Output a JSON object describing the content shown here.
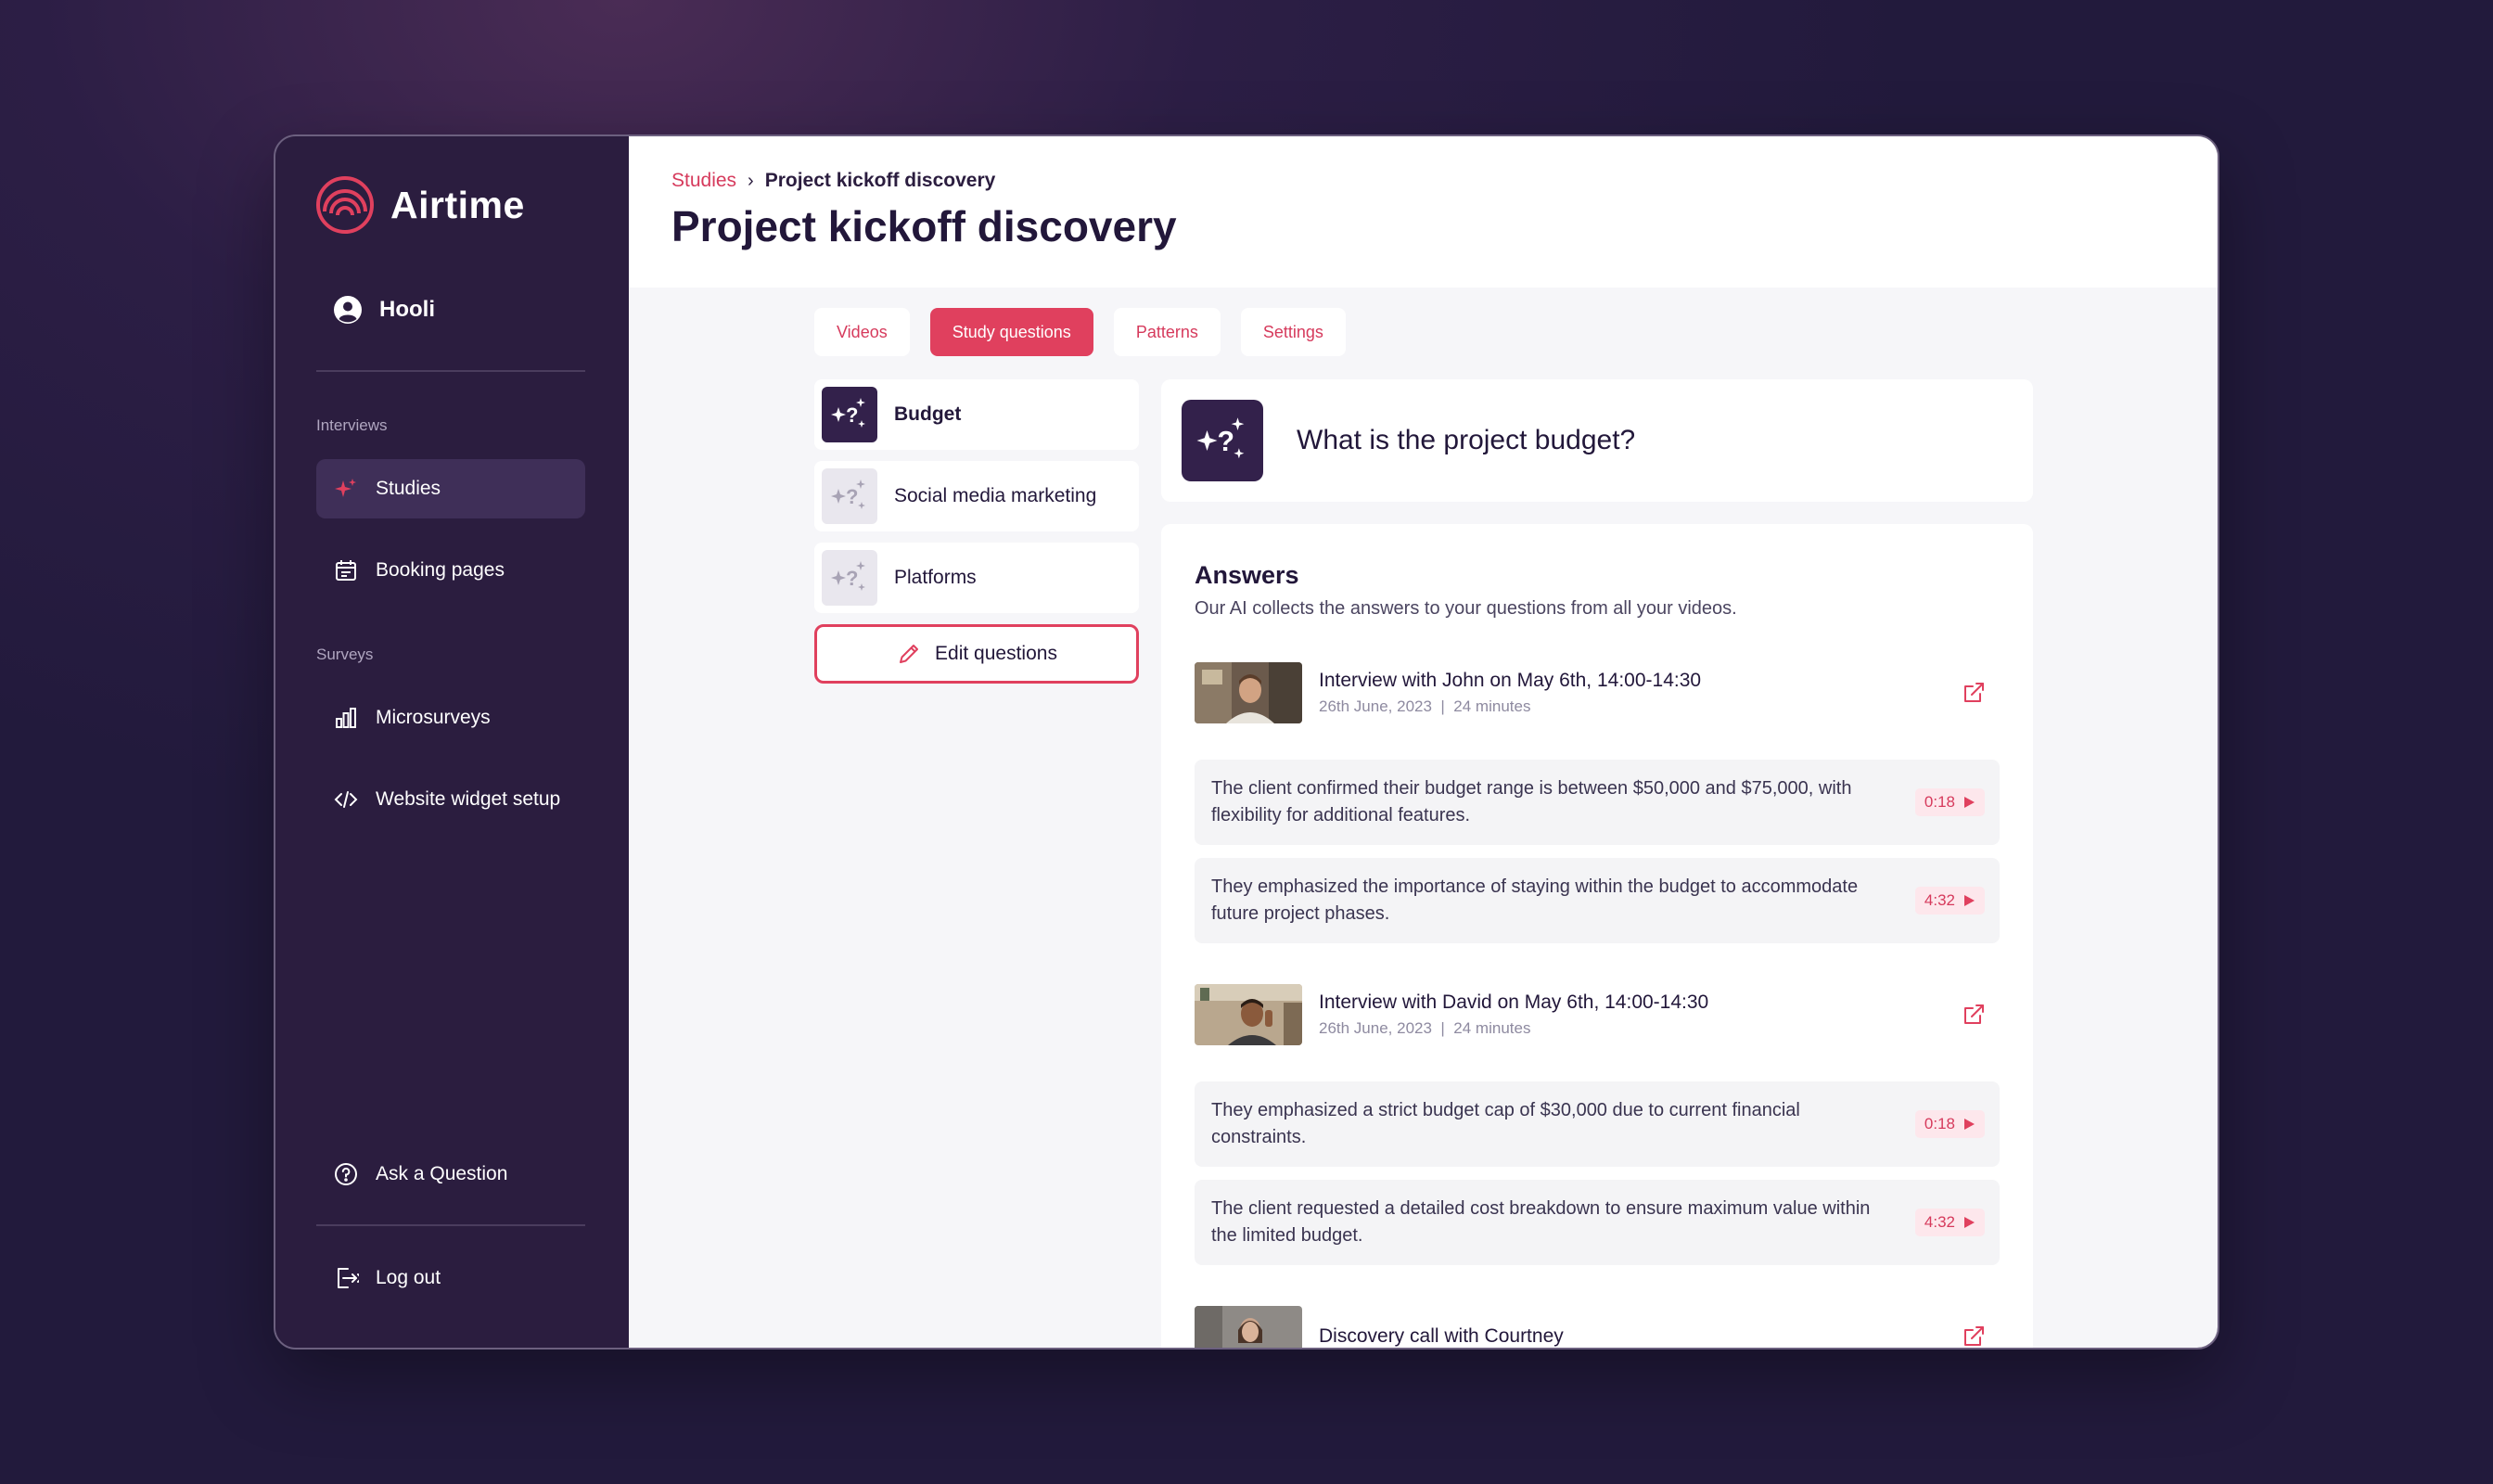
{
  "brand": {
    "name": "Airtime",
    "accent": "#e0405e",
    "sidebar_bg": "#2b1d3f"
  },
  "account": {
    "name": "Hooli",
    "icon": "user-circle-icon"
  },
  "sidebar": {
    "section_interviews": "Interviews",
    "section_surveys": "Surveys",
    "items": [
      {
        "label": "Studies",
        "icon": "sparkle-icon",
        "active": true
      },
      {
        "label": "Booking pages",
        "icon": "calendar-icon"
      },
      {
        "label": "Microsurveys",
        "icon": "bar-chart-icon"
      },
      {
        "label": "Website widget setup",
        "icon": "code-icon"
      }
    ],
    "ask_question": "Ask a Question",
    "logout": "Log out"
  },
  "breadcrumb": {
    "root": "Studies",
    "current": "Project kickoff discovery"
  },
  "page": {
    "title": "Project kickoff discovery"
  },
  "tabs": [
    {
      "label": "Videos"
    },
    {
      "label": "Study questions",
      "active": true
    },
    {
      "label": "Patterns"
    },
    {
      "label": "Settings"
    }
  ],
  "questions": [
    {
      "label": "Budget",
      "active": true
    },
    {
      "label": "Social media marketing"
    },
    {
      "label": "Platforms"
    }
  ],
  "edit_questions": "Edit questions",
  "selected_question": "What is the project budget?",
  "answers": {
    "title": "Answers",
    "subtitle": "Our AI collects the answers to your questions from all your videos.",
    "interviews": [
      {
        "title": "Interview with John on May 6th, 14:00-14:30",
        "date": "26th June, 2023",
        "duration": "24 minutes",
        "items": [
          {
            "text": "The client confirmed their budget range is between $50,000 and $75,000, with flexibility for additional features.",
            "time": "0:18"
          },
          {
            "text": "They emphasized the importance of staying within the budget to accommodate future project phases.",
            "time": "4:32"
          }
        ]
      },
      {
        "title": "Interview with David on May 6th, 14:00-14:30",
        "date": "26th June, 2023",
        "duration": "24 minutes",
        "items": [
          {
            "text": "They emphasized a strict budget cap of $30,000 due to current financial constraints.",
            "time": "0:18"
          },
          {
            "text": "The client requested a detailed cost breakdown to ensure maximum value within the limited budget.",
            "time": "4:32"
          }
        ]
      },
      {
        "title": "Discovery call with Courtney"
      }
    ]
  }
}
